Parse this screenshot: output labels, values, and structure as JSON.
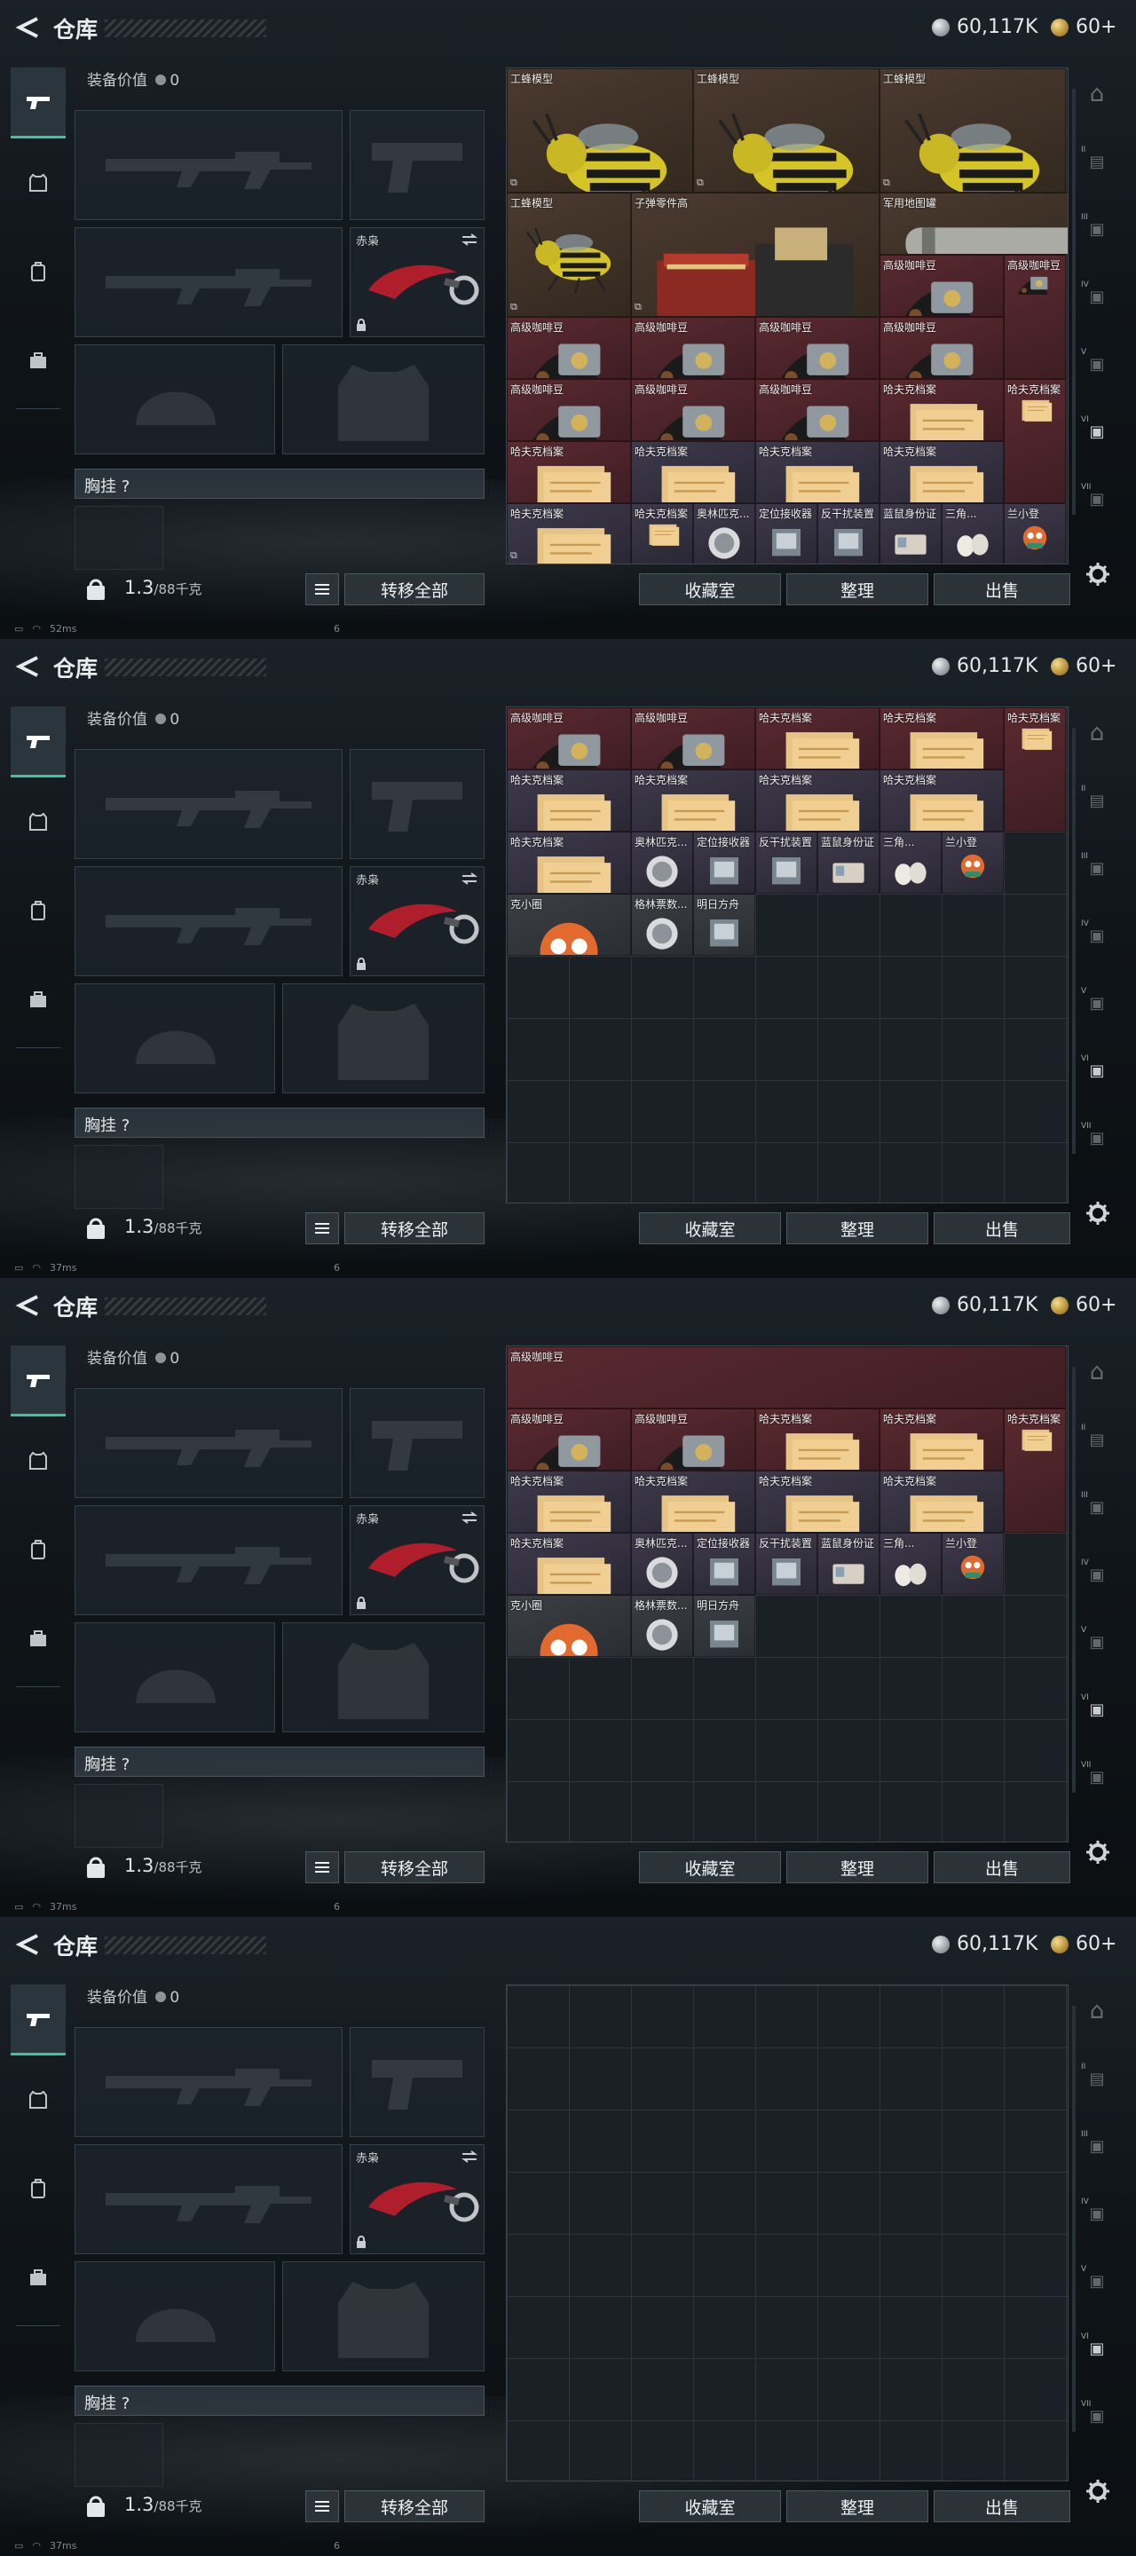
{
  "header": {
    "title": "仓库",
    "currency_silver": "60,117K",
    "currency_gold": "60+"
  },
  "equipment": {
    "value_label": "装备价值",
    "value": "0",
    "knife_label": "赤枭",
    "chest_label": "胸挂",
    "chest_value": "?"
  },
  "footer": {
    "weight": "1.3",
    "weight_max": "/88千克",
    "transfer_all": "转移全部",
    "collection": "收藏室",
    "organize": "整理",
    "sell": "出售"
  },
  "status": {
    "ping_1": "52ms",
    "ping_2": "37ms",
    "ping_3": "37ms",
    "ping_4": "37ms",
    "slot_num": "6"
  },
  "stash_panel_1": [
    {
      "label": "工蜂模型",
      "kind": "bee",
      "bg": "brown"
    },
    {
      "label": "工蜂模型",
      "kind": "bee",
      "bg": "brown"
    },
    {
      "label": "工蜂模型",
      "kind": "bee",
      "bg": "brown"
    },
    {
      "label": "工蜂模型",
      "kind": "bee",
      "bg": "brown"
    },
    {
      "label": "子弹零件高",
      "kind": "parts",
      "bg": "brown"
    },
    {
      "label": "军用地图罐",
      "kind": "tube",
      "bg": "brown"
    },
    {
      "label": "高级咖啡豆",
      "kind": "coffee",
      "bg": "red"
    },
    {
      "label": "高级咖啡豆",
      "kind": "coffee",
      "bg": "red"
    },
    {
      "label": "高级咖啡豆",
      "kind": "coffee",
      "bg": "red"
    },
    {
      "label": "高级咖啡豆",
      "kind": "coffee",
      "bg": "red"
    },
    {
      "label": "高级咖啡豆",
      "kind": "coffee",
      "bg": "red"
    },
    {
      "label": "高级咖啡豆",
      "kind": "coffee",
      "bg": "red"
    },
    {
      "label": "高级咖啡豆",
      "kind": "coffee",
      "bg": "red"
    },
    {
      "label": "高级咖啡豆",
      "kind": "coffee",
      "bg": "red"
    },
    {
      "label": "高级咖啡豆",
      "kind": "coffee",
      "bg": "red"
    },
    {
      "label": "哈夫克档案",
      "kind": "file",
      "bg": "red"
    },
    {
      "label": "哈夫克档案",
      "kind": "file",
      "bg": "red"
    },
    {
      "label": "哈夫克档案",
      "kind": "file",
      "bg": "red"
    },
    {
      "label": "哈夫克档案",
      "kind": "file",
      "bg": "purple"
    },
    {
      "label": "哈夫克档案",
      "kind": "file",
      "bg": "purple"
    },
    {
      "label": "哈夫克档案",
      "kind": "file",
      "bg": "purple"
    },
    {
      "label": "哈夫克档案",
      "kind": "file",
      "bg": "purple"
    },
    {
      "label": "哈夫克档案",
      "kind": "file",
      "bg": "purple"
    },
    {
      "label": "奥林匹克...",
      "kind": "medal",
      "bg": "purple"
    },
    {
      "label": "定位接收器",
      "kind": "device",
      "bg": "purple"
    },
    {
      "label": "反干扰装置",
      "kind": "device",
      "bg": "purple"
    },
    {
      "label": "蓝鼠身份证",
      "kind": "card",
      "bg": "purple"
    },
    {
      "label": "三角...",
      "kind": "eggs",
      "bg": "purple"
    },
    {
      "label": "兰小登",
      "kind": "toy",
      "bg": "purple"
    }
  ],
  "stash_panel_2": [
    {
      "label": "高级咖啡豆",
      "kind": "coffee",
      "bg": "red"
    },
    {
      "label": "高级咖啡豆",
      "kind": "coffee",
      "bg": "red"
    },
    {
      "label": "哈夫克档案",
      "kind": "file",
      "bg": "red"
    },
    {
      "label": "哈夫克档案",
      "kind": "file",
      "bg": "red"
    },
    {
      "label": "哈夫克档案",
      "kind": "file",
      "bg": "red"
    },
    {
      "label": "哈夫克档案",
      "kind": "file",
      "bg": "purple"
    },
    {
      "label": "哈夫克档案",
      "kind": "file",
      "bg": "purple"
    },
    {
      "label": "哈夫克档案",
      "kind": "file",
      "bg": "purple"
    },
    {
      "label": "哈夫克档案",
      "kind": "file",
      "bg": "purple"
    },
    {
      "label": "哈夫克档案",
      "kind": "file",
      "bg": "purple"
    },
    {
      "label": "奥林匹克...",
      "kind": "medal",
      "bg": "purple"
    },
    {
      "label": "定位接收器",
      "kind": "device",
      "bg": "purple"
    },
    {
      "label": "反干扰装置",
      "kind": "device",
      "bg": "purple"
    },
    {
      "label": "蓝鼠身份证",
      "kind": "card",
      "bg": "purple"
    },
    {
      "label": "三角...",
      "kind": "eggs",
      "bg": "purple"
    },
    {
      "label": "兰小登",
      "kind": "toy",
      "bg": "purple"
    },
    {
      "label": "克小圈",
      "kind": "toy",
      "bg": "gray"
    },
    {
      "label": "格林票数...",
      "kind": "medal",
      "bg": "gray"
    },
    {
      "label": "明日方舟",
      "kind": "device",
      "bg": "gray"
    }
  ],
  "right_nav": [
    "I",
    "II",
    "III",
    "IV",
    "V",
    "VI",
    "VII"
  ]
}
